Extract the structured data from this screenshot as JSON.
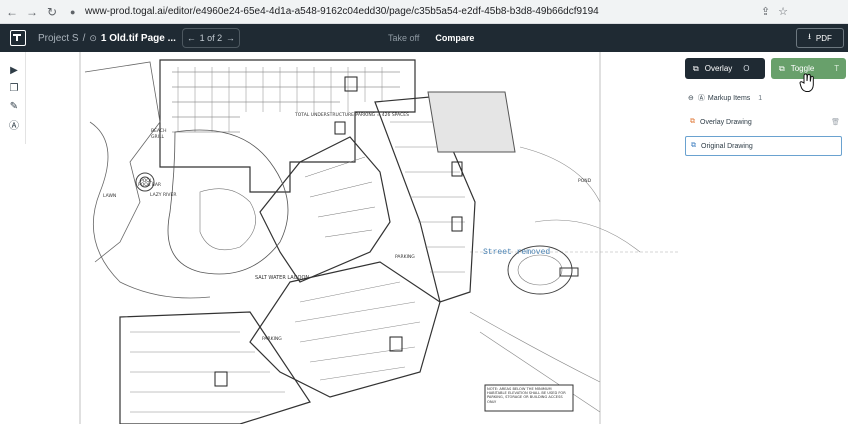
{
  "browser": {
    "url": "www-prod.togal.ai/editor/e4960e24-65e4-4d1a-a548-9162c04edd30/page/c35b5a54-e2df-45b8-b3d8-49b66dcf9194"
  },
  "header": {
    "project": "Project S",
    "page": "1 Old.tif Page ...",
    "pager": "1 of 2",
    "tabs": [
      "Take off",
      "Compare"
    ],
    "active_tab": "Compare",
    "pdf_label": "PDF"
  },
  "panel": {
    "overlay_label": "Overlay",
    "overlay_key": "O",
    "toggle_label": "Toggle",
    "toggle_key": "T",
    "markup_label": "Markup Items",
    "markup_count": "1",
    "drawings": [
      "Overlay Drawing",
      "Original Drawing"
    ]
  },
  "canvas": {
    "street_label": "Street removed",
    "labels": {
      "parking_top": "TOTAL UNDERSTRUCTURE PARKING = 426 SPACES",
      "salt_lagoon": "SALT WATER LAGOON",
      "lawn": "LAWN",
      "pool": "POOL",
      "pool_bar": "POOL BAR",
      "beach": "BEACH",
      "grill": "GRILL",
      "pond": "POND",
      "lazy_river": "LAZY RIVER",
      "parking_mid": "PARKING",
      "parking_low": "PARKING",
      "note": "NOTE: AREAS BELOW THE MINIMUM HABITABLE ELEVATION SHALL BE USED FOR PARKING, STORAGE OR BUILDING ACCESS ONLY"
    }
  },
  "colors": {
    "app_bar": "#1f2a33",
    "toggle_green": "#68a06b",
    "street_blue": "#4b83b3"
  }
}
